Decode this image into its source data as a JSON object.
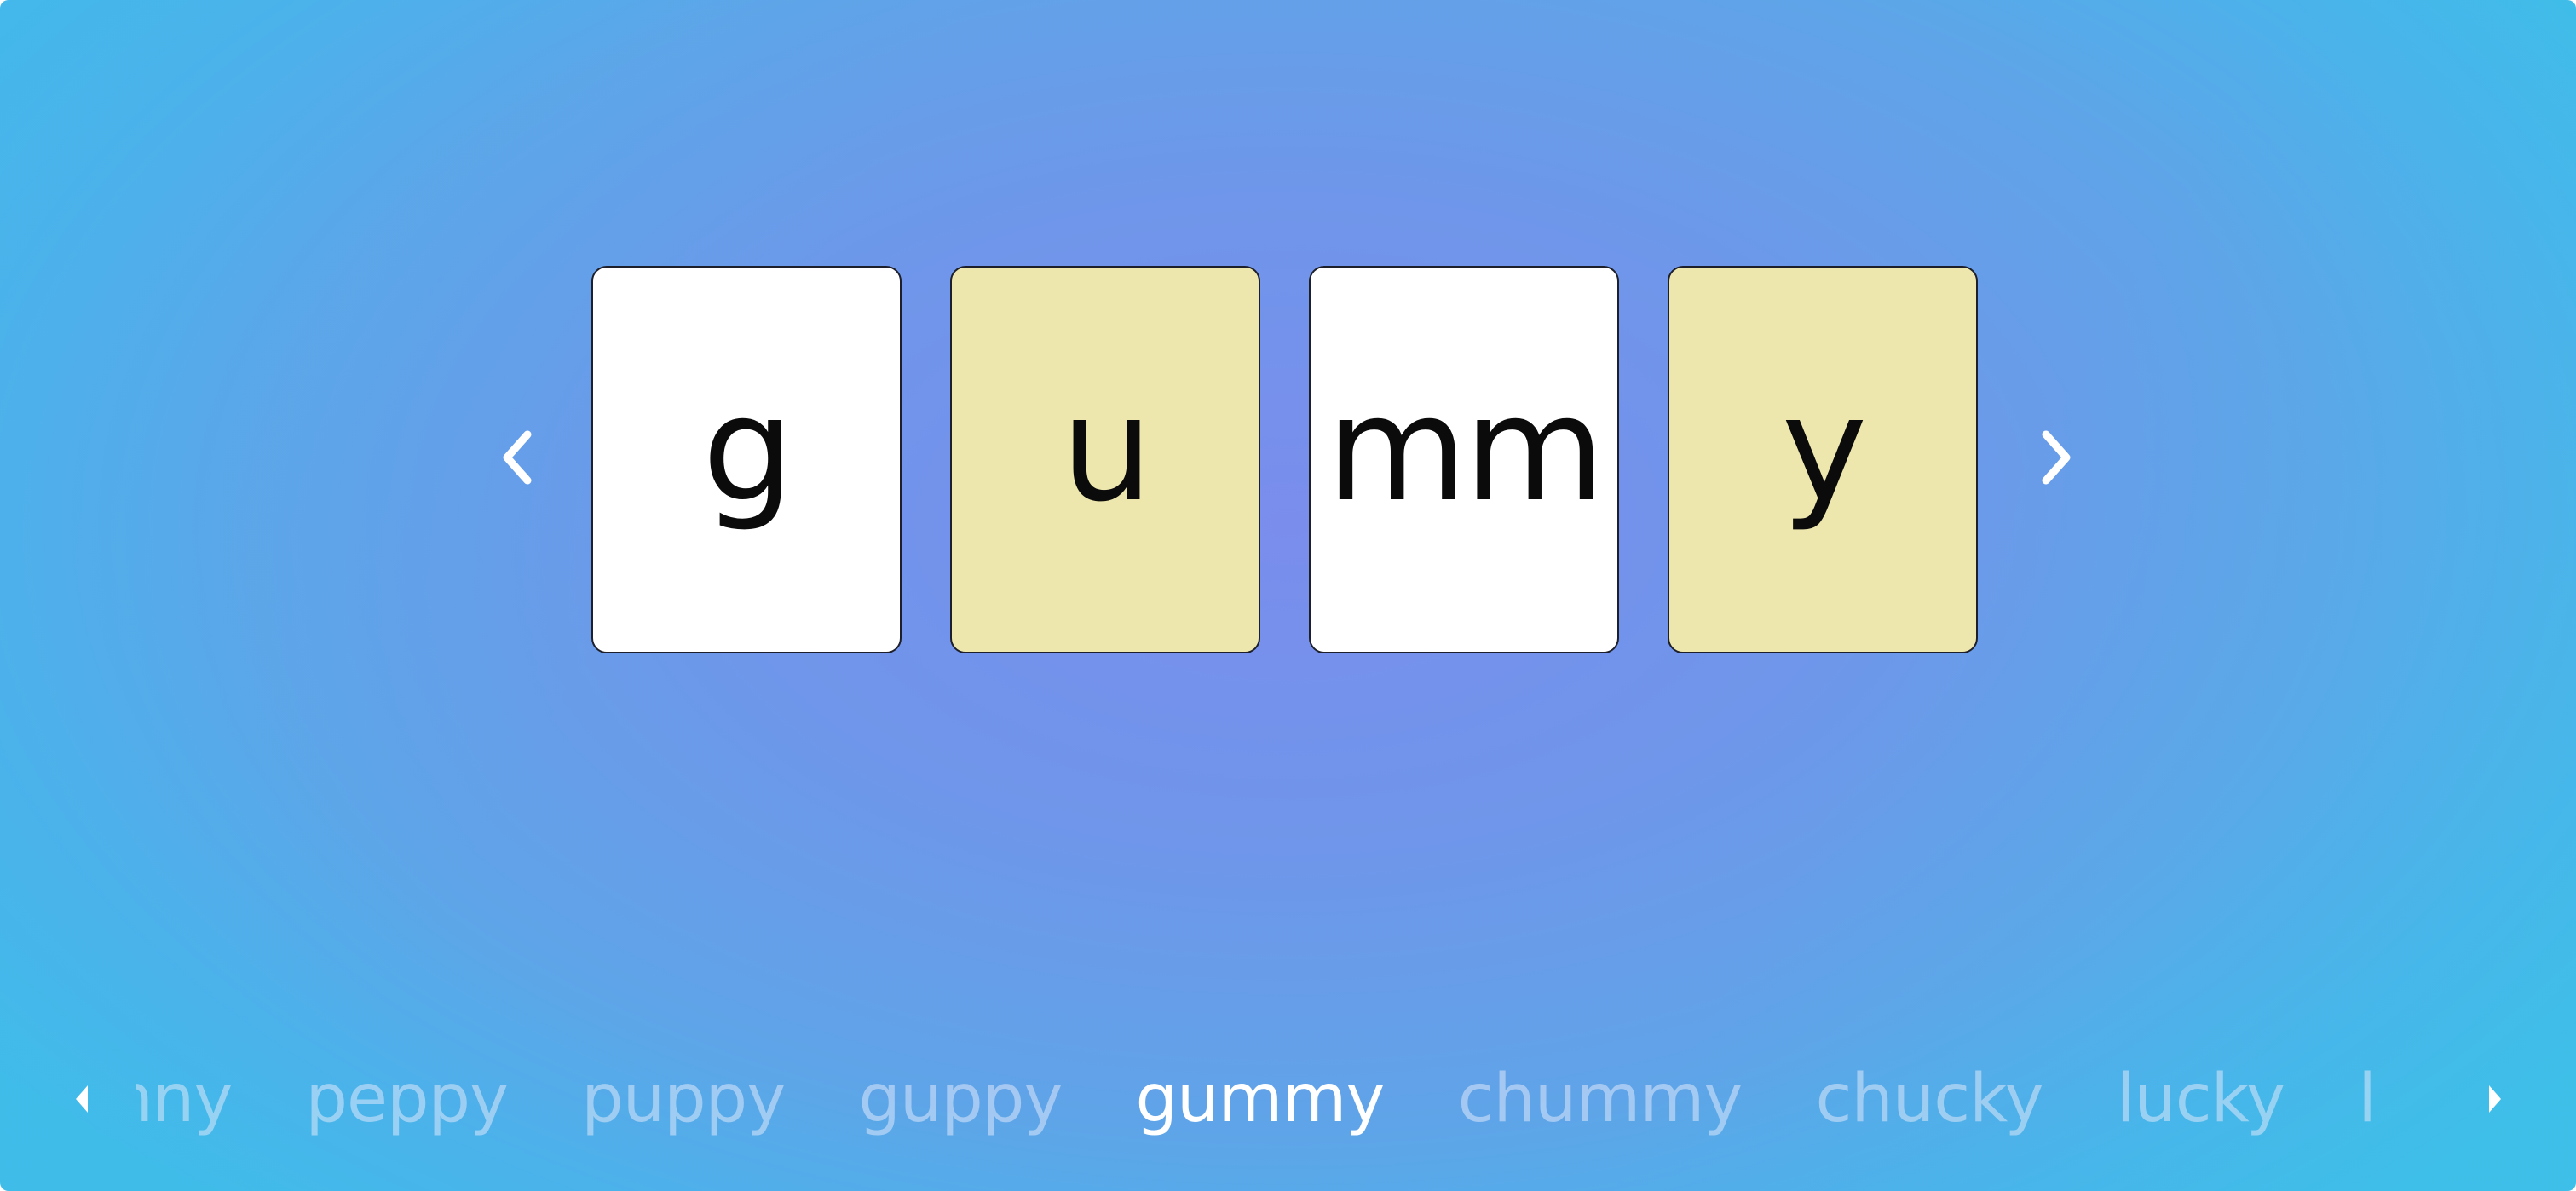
{
  "cards": [
    {
      "text": "g",
      "color": "#ffffff"
    },
    {
      "text": "u",
      "color": "#ede7ae"
    },
    {
      "text": "mm",
      "color": "#ffffff"
    },
    {
      "text": "y",
      "color": "#ede7ae"
    }
  ],
  "nav": {
    "prev_icon": "chevron-left-icon",
    "next_icon": "chevron-right-icon"
  },
  "word_strip": {
    "prev_icon": "triangle-left-icon",
    "next_icon": "triangle-right-icon",
    "words": [
      "penny",
      "peppy",
      "puppy",
      "guppy",
      "gummy",
      "chummy",
      "chucky",
      "lucky",
      "l"
    ],
    "active_word": "gummy"
  },
  "colors": {
    "card_white": "#ffffff",
    "card_yellow": "#ede7ae",
    "active_word": "#ffffff",
    "inactive_word": "#dce8fa"
  }
}
